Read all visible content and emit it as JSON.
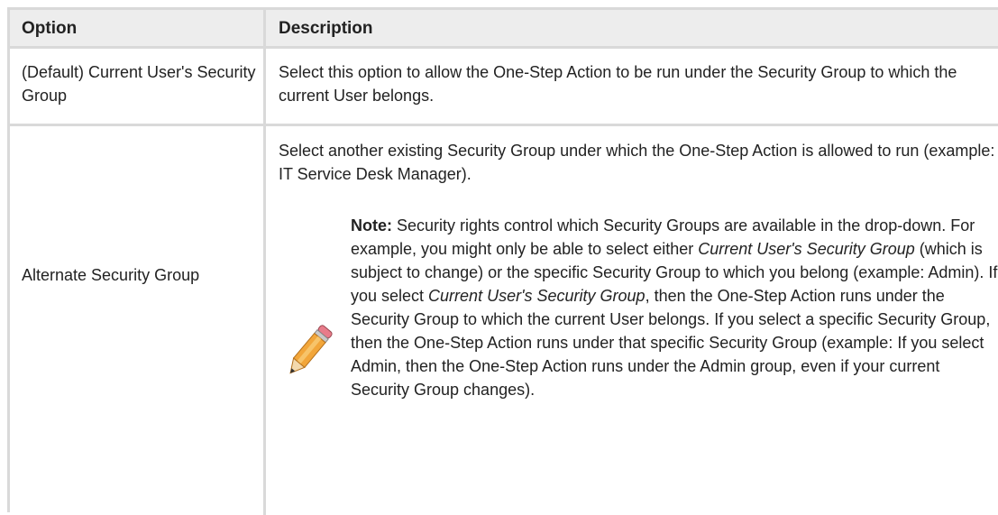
{
  "table": {
    "headers": {
      "option": "Option",
      "description": "Description"
    },
    "rows": [
      {
        "option": "(Default) Current User's Security Group",
        "description": "Select this option to allow the One-Step Action to be run under the Security Group to which the current User belongs."
      },
      {
        "option": "Alternate Security Group",
        "description": "Select another existing Security Group under which the One-Step Action is allowed to run (example: IT Service Desk Manager).",
        "note": {
          "label": "Note:",
          "text_1": " Security rights control which Security Groups are available in the drop-down. For example, you might only be able to select either ",
          "italic_1": "Current User's Security Group",
          "text_2": " (which is subject to change) or the specific Security Group to which you belong (example: Admin). If you select ",
          "italic_2": "Current User's Security Group",
          "text_3": ", then the One-Step Action runs under the Security Group to which the current User belongs. If you select a specific Security Group, then the One-Step Action runs under that specific Security Group (example: If you select Admin, then the One-Step Action runs under the Admin group, even if your current Security Group changes).",
          "icon": "pencil-icon"
        }
      }
    ]
  }
}
